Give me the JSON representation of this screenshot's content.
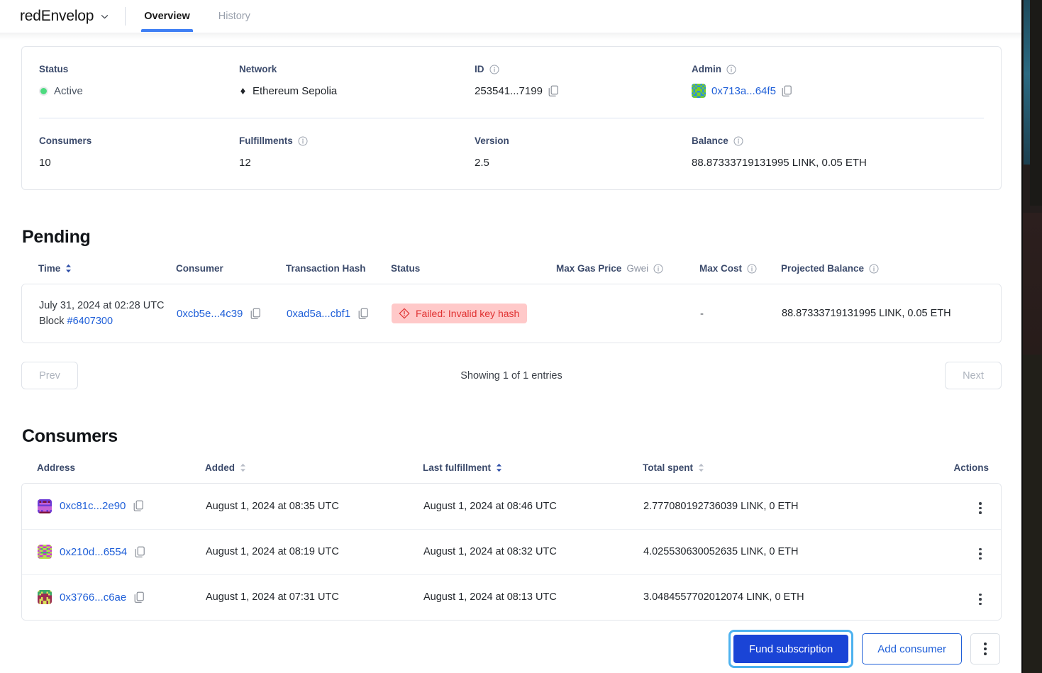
{
  "header": {
    "project_name": "redEnvelop",
    "project_picker_icon": "chevron-down-icon",
    "tabs": [
      {
        "label": "Overview",
        "active": true
      },
      {
        "label": "History",
        "active": false
      }
    ]
  },
  "summary": {
    "status": {
      "label": "Status",
      "value": "Active",
      "dot_color": "#4ddb7f"
    },
    "network": {
      "label": "Network",
      "value": "Ethereum Sepolia",
      "icon": "ethereum-icon"
    },
    "id": {
      "label": "ID",
      "value": "253541...7199",
      "has_info": true,
      "copy_icon": "copy-icon"
    },
    "admin": {
      "label": "Admin",
      "value": "0x713a...64f5",
      "has_info": true,
      "copy_icon": "copy-icon",
      "identicon": "admin-identicon"
    },
    "consumers": {
      "label": "Consumers",
      "value": "10"
    },
    "fulfillments": {
      "label": "Fulfillments",
      "value": "12",
      "has_info": true
    },
    "version": {
      "label": "Version",
      "value": "2.5"
    },
    "balance": {
      "label": "Balance",
      "value": "88.87333719131995 LINK, 0.05 ETH",
      "has_info": true
    }
  },
  "pending": {
    "title": "Pending",
    "columns": [
      {
        "label": "Time",
        "sortable": true
      },
      {
        "label": "Consumer",
        "sortable": false
      },
      {
        "label": "Transaction Hash",
        "sortable": false
      },
      {
        "label": "Status",
        "sortable": false
      },
      {
        "label": "Max Gas Price",
        "unit": "Gwei",
        "has_info": true
      },
      {
        "label": "Max Cost",
        "has_info": true
      },
      {
        "label": "Projected Balance",
        "has_info": true
      }
    ],
    "rows": [
      {
        "time": "July 31, 2024 at 02:28 UTC",
        "block_prefix": "Block ",
        "block": "#6407300",
        "consumer": "0xcb5e...4c39",
        "tx_hash": "0xad5a...cbf1",
        "status": "Failed: Invalid key hash",
        "status_type": "failed",
        "max_gas_price": "",
        "max_cost": "-",
        "projected_balance": "88.87333719131995 LINK, 0.05 ETH"
      }
    ],
    "pagination": {
      "prev_label": "Prev",
      "next_label": "Next",
      "showing_text": "Showing 1 of 1 entries"
    }
  },
  "consumers": {
    "title": "Consumers",
    "columns": [
      {
        "label": "Address",
        "sortable": false
      },
      {
        "label": "Added",
        "sortable": true
      },
      {
        "label": "Last fulfillment",
        "sortable": true
      },
      {
        "label": "Total spent",
        "sortable": true
      },
      {
        "label": "Actions",
        "sortable": false
      }
    ],
    "rows": [
      {
        "address": "0xc81c...2e90",
        "added": "August 1, 2024 at 08:35 UTC",
        "last_fulfillment": "August 1, 2024 at 08:46 UTC",
        "total_spent": "2.777080192736039 LINK, 0 ETH"
      },
      {
        "address": "0x210d...6554",
        "added": "August 1, 2024 at 08:19 UTC",
        "last_fulfillment": "August 1, 2024 at 08:32 UTC",
        "total_spent": "4.025530630052635 LINK, 0 ETH"
      },
      {
        "address": "0x3766...c6ae",
        "added": "August 1, 2024 at 07:31 UTC",
        "last_fulfillment": "August 1, 2024 at 08:13 UTC",
        "total_spent": "3.0484557702012074 LINK, 0 ETH"
      }
    ]
  },
  "action_bar": {
    "fund_label": "Fund subscription",
    "add_consumer_label": "Add consumer",
    "more_icon": "kebab-menu-icon"
  },
  "colors": {
    "accent_blue": "#1f5fd8",
    "primary_button": "#1a44d6",
    "focus_ring": "#4db2ef",
    "tab_underline": "#3f7ff4",
    "status_green": "#4ddb7f",
    "error_bg": "#ffc9c9",
    "error_text": "#e03131",
    "label_blue": "#3b4a6b"
  }
}
